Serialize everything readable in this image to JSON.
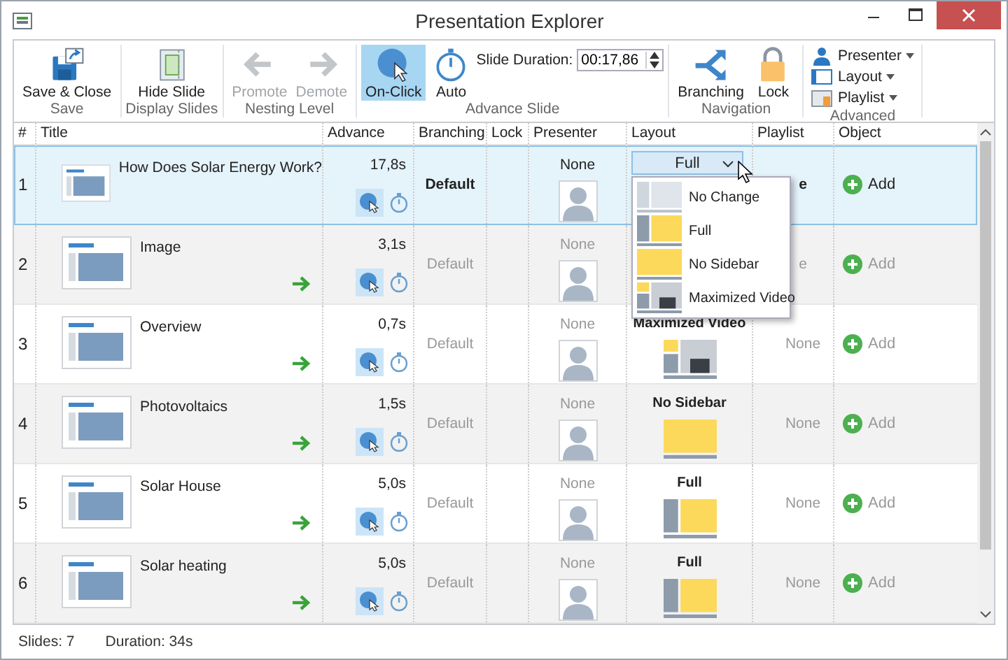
{
  "window": {
    "title": "Presentation Explorer"
  },
  "ribbon": {
    "groups": [
      {
        "label": "Save",
        "buttons": [
          {
            "kind": "save",
            "label": "Save & Close",
            "disabled": false,
            "selected": false
          }
        ]
      },
      {
        "label": "Display Slides",
        "buttons": [
          {
            "kind": "hide",
            "label": "Hide Slide",
            "disabled": false,
            "selected": false
          }
        ]
      },
      {
        "label": "Nesting Level",
        "buttons": [
          {
            "kind": "left",
            "label": "Promote",
            "disabled": true,
            "selected": false
          },
          {
            "kind": "right",
            "label": "Demote",
            "disabled": true,
            "selected": false
          }
        ]
      },
      {
        "label": "Advance Slide",
        "buttons": [
          {
            "kind": "click",
            "label": "On-Click",
            "disabled": false,
            "selected": true
          },
          {
            "kind": "timer",
            "label": "Auto",
            "disabled": false,
            "selected": false
          }
        ],
        "duration": {
          "label": "Slide Duration:",
          "value": "00:17,86"
        }
      },
      {
        "label": "Navigation",
        "buttons": [
          {
            "kind": "branch",
            "label": "Branching",
            "disabled": false,
            "selected": false
          },
          {
            "kind": "lock",
            "label": "Lock",
            "disabled": false,
            "selected": false
          }
        ]
      },
      {
        "label": "Advanced",
        "menus": [
          {
            "kind": "person",
            "label": "Presenter"
          },
          {
            "kind": "layout",
            "label": "Layout"
          },
          {
            "kind": "playlist",
            "label": "Playlist"
          }
        ]
      }
    ]
  },
  "table": {
    "columns": [
      "#",
      "Title",
      "Advance",
      "Branching",
      "Lock",
      "Presenter",
      "Layout",
      "Playlist",
      "Object"
    ],
    "rows": [
      {
        "num": "1",
        "title": "How Does Solar Energy Work?",
        "selected": true,
        "arrow": false,
        "advance": "17,8s",
        "on_click": true,
        "branching": "Default",
        "presenter": "None",
        "layout": {
          "kind": "combo",
          "label": "Full"
        },
        "playlist": "e",
        "object": "Add"
      },
      {
        "num": "2",
        "title": "Image",
        "selected": false,
        "arrow": true,
        "advance": "3,1s",
        "on_click": true,
        "branching": "Default",
        "presenter": "None",
        "playlist": "e",
        "object": "Add"
      },
      {
        "num": "3",
        "title": "Overview",
        "selected": false,
        "arrow": true,
        "advance": "0,7s",
        "on_click": true,
        "branching": "Default",
        "presenter": "None",
        "layout": {
          "kind": "max-video",
          "label": "Maximized Video"
        },
        "playlist": "None",
        "object": "Add"
      },
      {
        "num": "4",
        "title": "Photovoltaics",
        "selected": false,
        "arrow": true,
        "advance": "1,5s",
        "on_click": true,
        "branching": "Default",
        "presenter": "None",
        "layout": {
          "kind": "no-sidebar",
          "label": "No Sidebar"
        },
        "playlist": "None",
        "object": "Add"
      },
      {
        "num": "5",
        "title": "Solar House",
        "selected": false,
        "arrow": true,
        "advance": "5,0s",
        "on_click": true,
        "branching": "Default",
        "presenter": "None",
        "layout": {
          "kind": "full",
          "label": "Full"
        },
        "playlist": "None",
        "object": "Add"
      },
      {
        "num": "6",
        "title": "Solar heating",
        "selected": false,
        "arrow": true,
        "advance": "5,0s",
        "on_click": true,
        "branching": "Default",
        "presenter": "None",
        "layout": {
          "kind": "full",
          "label": "Full"
        },
        "playlist": "None",
        "object": "Add"
      }
    ]
  },
  "layout_dropdown": {
    "options": [
      {
        "label": "No Change",
        "kind": "no-change",
        "selected": false
      },
      {
        "label": "Full",
        "kind": "full",
        "selected": false
      },
      {
        "label": "No Sidebar",
        "kind": "no-sidebar",
        "selected": false
      },
      {
        "label": "Maximized Video",
        "kind": "max-video",
        "selected": false
      }
    ]
  },
  "status_bar": {
    "slides": "Slides: 7",
    "duration": "Duration: 34s"
  }
}
